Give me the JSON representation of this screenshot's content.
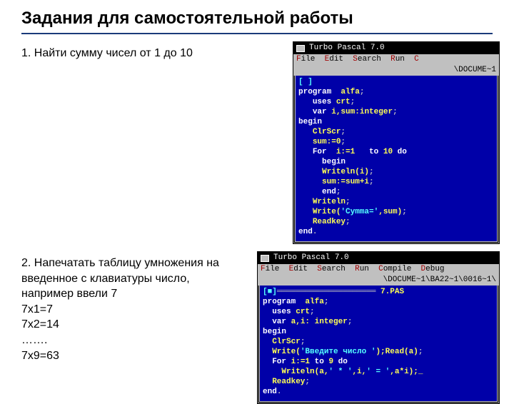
{
  "title": "Задания для самостоятельной работы",
  "task1": {
    "text": "1. Найти  сумму  чисел  от 1  до 10",
    "ide": {
      "title": "Turbo Pascal 7.0",
      "menu": " File  Edit  Search  Run  C",
      "path": "\\DOCUME~1",
      "code_prefix": "[ ]",
      "code_lines": [
        "program  alfa;",
        "   uses crt;",
        "   var i,sum:integer;",
        "begin",
        "   ClrScr;",
        "   sum:=0;",
        "   For  i:=1   to 10 do",
        "     begin",
        "     Writeln(i);",
        "     sum:=sum+i;",
        "     end;",
        "   Writeln;",
        "   Write('Cymma=',sum);",
        "   Readkey;",
        "end."
      ]
    }
  },
  "task2": {
    "text": "2. Напечатать  таблицу  умножения  на\nвведенное с  клавиатуры  число, например  ввели 7\n7х1=7\n7х2=14\n…….\n7х9=63",
    "ide": {
      "title": "Turbo Pascal 7.0",
      "menu": " File  Edit  Search  Run  Compile  Debug",
      "path": "\\DOCUME~1\\BA22~1\\0016~1\\",
      "file_label": "7.PAS",
      "code_prefix": "[■]",
      "code_lines": [
        "program  alfa;",
        "  uses crt;",
        "  var a,i: integer;",
        "begin",
        "  ClrScr;",
        "  Write('Введите число ');Read(a);",
        "  For i:=1 to 9 do",
        "    Writeln(a,' * ',i,' = ',a*i);_",
        "  Readkey;",
        "end."
      ]
    }
  }
}
